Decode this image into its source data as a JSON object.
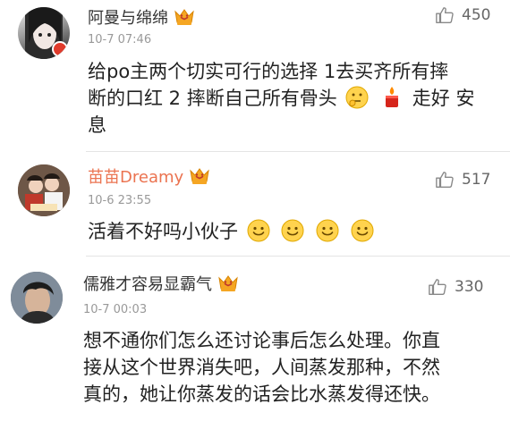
{
  "comments": [
    {
      "user": "阿曼与绵绵",
      "name_color": "#333333",
      "time": "10-7 07:46",
      "likes": "450",
      "text_line1": "给po主两个切实可行的选择 1去买齐所有摔",
      "text_line2_a": "断的口红 2 摔断自己所有骨头",
      "text_line2_b": "走好 安",
      "text_line3": "息"
    },
    {
      "user": "苗苗Dreamy",
      "name_color": "#eb7350",
      "time": "10-6 23:55",
      "likes": "517",
      "text_line1": "活着不好吗小伙子"
    },
    {
      "user": "儒雅才容易显霸气",
      "name_color": "#333333",
      "time": "10-7 00:03",
      "likes": "330",
      "text_line1": "想不通你们怎么还讨论事后怎么处理。你直",
      "text_line2": "接从这个世界消失吧，人间蒸发那种，不然",
      "text_line3": "真的，她让你蒸发的话会比水蒸发得还快。"
    }
  ],
  "icons": {
    "like": "thumbs-up-icon",
    "vip_badge": "vip-crown-badge-icon",
    "emoji_thinking": "thinking-face-emoji",
    "emoji_candle": "candle-emoji",
    "emoji_smile": "smile-emoji"
  },
  "colors": {
    "accent_orange": "#eb7350",
    "muted": "#999999"
  }
}
